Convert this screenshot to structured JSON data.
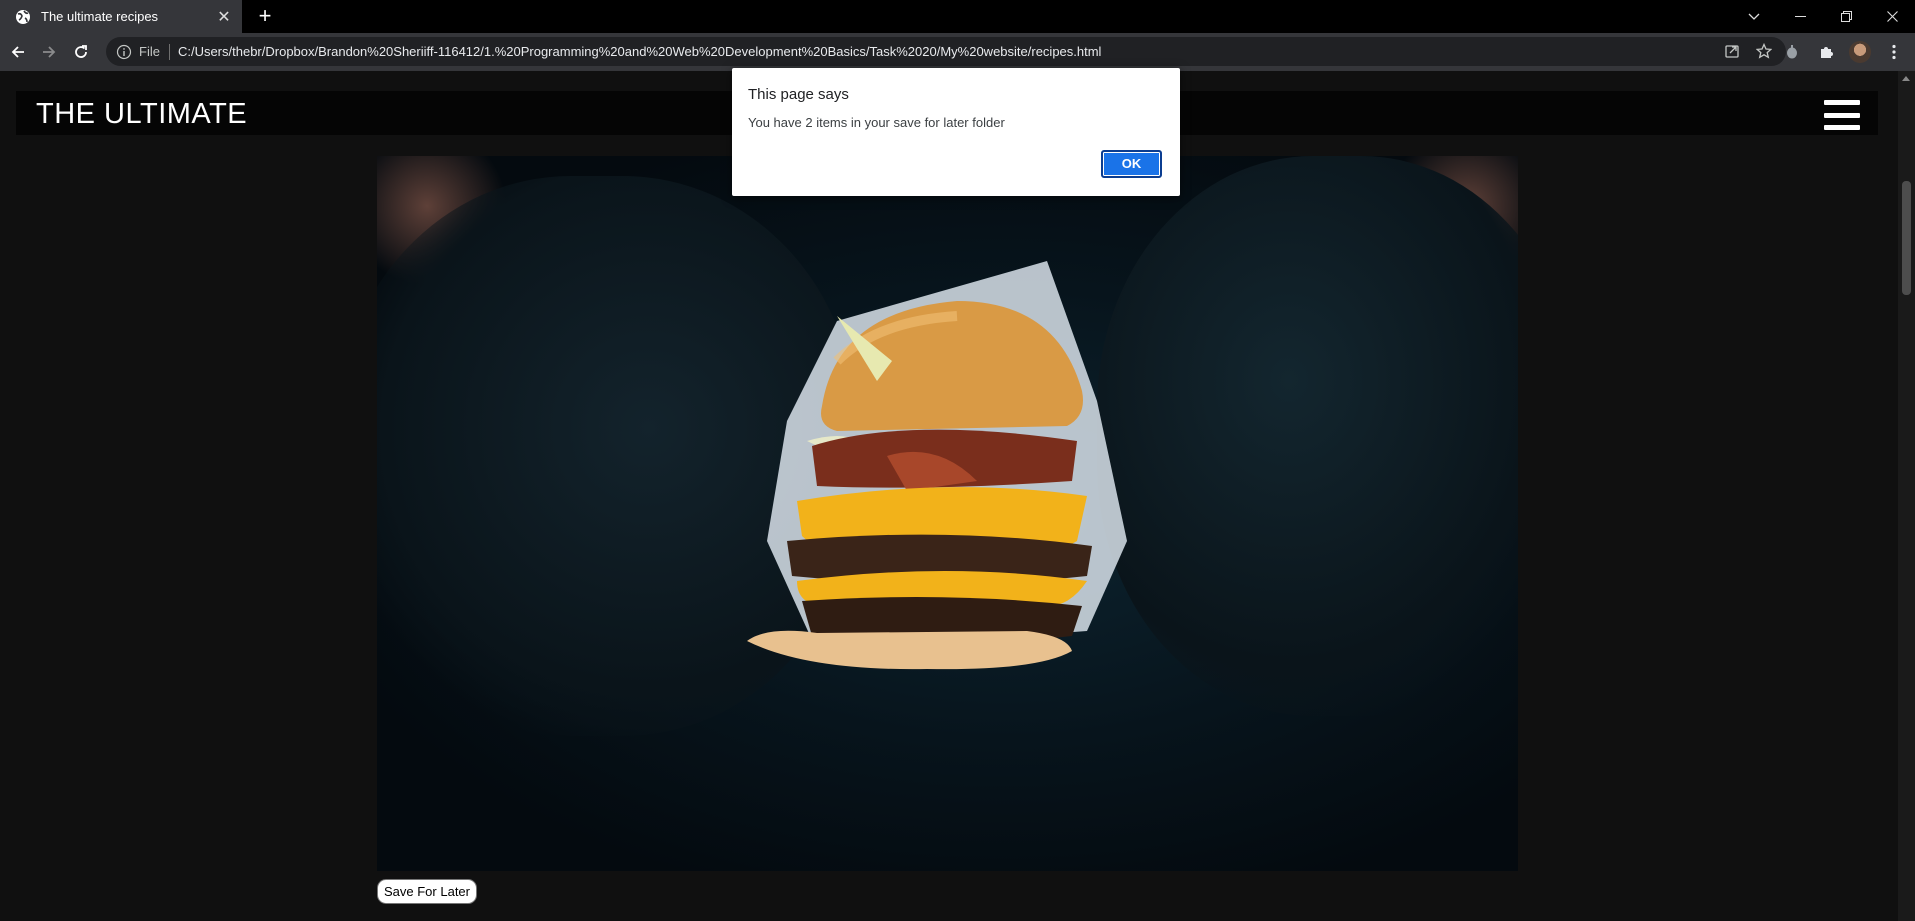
{
  "browser": {
    "tab_title": "The ultimate recipes",
    "omnibox_scheme": "File",
    "url": "C:/Users/thebr/Dropbox/Brandon%20Sheriiff-116412/1.%20Programming%20and%20Web%20Development%20Basics/Task%2020/My%20website/recipes.html"
  },
  "site": {
    "title": "THE ULTIMATE"
  },
  "page": {
    "save_button_label": "Save For Later"
  },
  "dialog": {
    "title": "This page says",
    "message": "You have 2 items in your save for later folder",
    "ok_label": "OK"
  },
  "icons": {
    "favicon": "globe-icon",
    "tab_close": "close-icon",
    "new_tab": "plus-icon",
    "back": "arrow-left-icon",
    "forward": "arrow-right-icon",
    "reload": "reload-icon",
    "site_info": "info-icon",
    "share": "share-icon",
    "bookmark": "star-icon",
    "extension": "extension-icon",
    "puzzle": "puzzle-icon",
    "menu": "kebab-menu-icon",
    "hamburger": "hamburger-icon"
  },
  "colors": {
    "chrome_bg": "#35363a",
    "page_bg": "#101010",
    "dialog_button": "#1a73e8"
  }
}
